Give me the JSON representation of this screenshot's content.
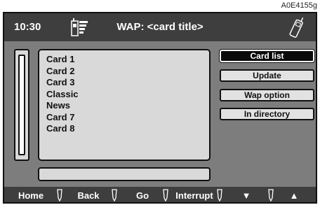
{
  "figure_ref": "A0E4155g",
  "titlebar": {
    "time": "10:30",
    "title": "WAP: <card title>",
    "signal_icon": "signal-strength-icon",
    "phone_icon": "mobile-phone-icon"
  },
  "card_list": {
    "items": [
      "Card 1",
      "Card 2",
      "Card 3",
      "Classic",
      "News",
      "Card 7",
      "Card 8"
    ]
  },
  "side_menu": {
    "items": [
      {
        "label": "Card list",
        "selected": true
      },
      {
        "label": "Update",
        "selected": false
      },
      {
        "label": "Wap option",
        "selected": false
      },
      {
        "label": "In directory",
        "selected": false
      }
    ]
  },
  "bottom_bar": {
    "buttons": [
      "Home",
      "Back",
      "Go",
      "Interrupt",
      "▼",
      "▲"
    ]
  },
  "colors": {
    "screen_bg": "#7d7d7d",
    "bar_bg": "#3e3e3e",
    "panel_bg": "#d9d9d9",
    "selected_bg": "#0a0a0a"
  }
}
